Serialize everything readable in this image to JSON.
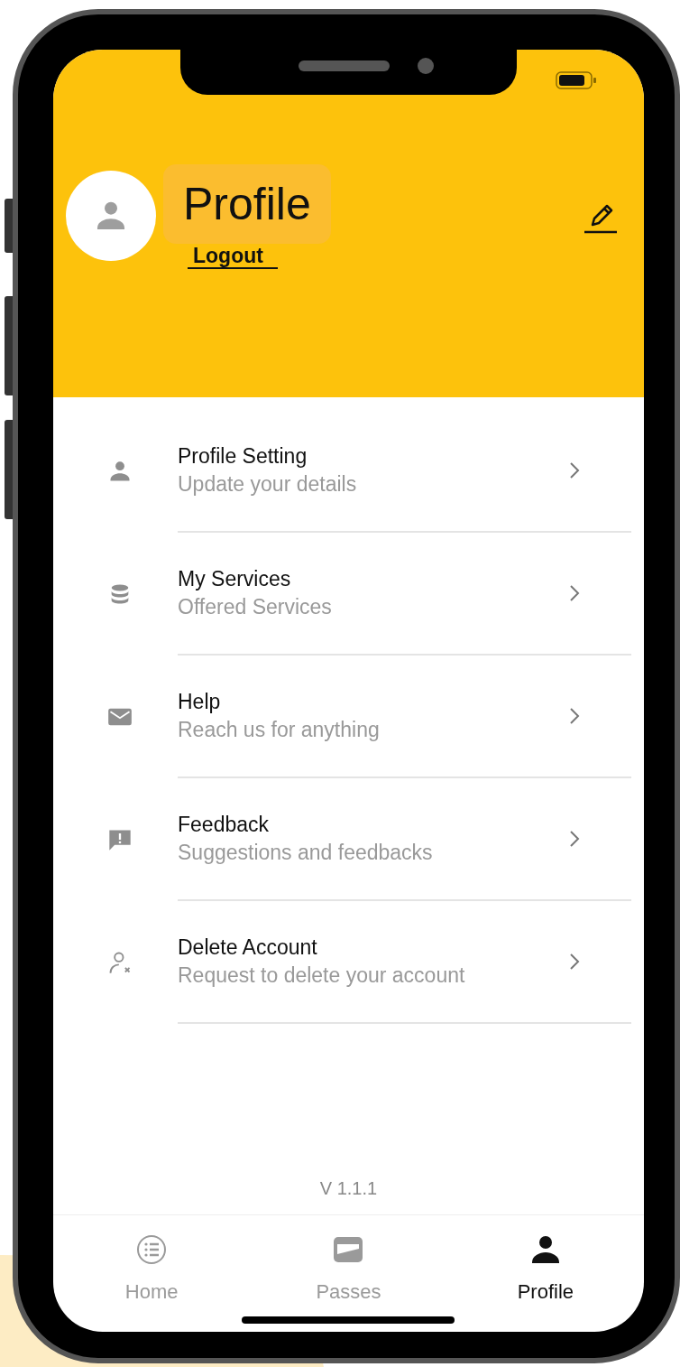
{
  "header": {
    "title": "Profile",
    "logout": "Logout"
  },
  "menu": [
    {
      "title": "Profile Setting",
      "subtitle": "Update your details"
    },
    {
      "title": "My Services",
      "subtitle": "Offered Services"
    },
    {
      "title": "Help",
      "subtitle": "Reach us for anything"
    },
    {
      "title": "Feedback",
      "subtitle": "Suggestions and feedbacks"
    },
    {
      "title": "Delete Account",
      "subtitle": "Request to delete your account"
    }
  ],
  "version": "V 1.1.1",
  "tabs": [
    {
      "label": "Home",
      "selected": false
    },
    {
      "label": "Passes",
      "selected": false
    },
    {
      "label": "Profile",
      "selected": true
    }
  ]
}
